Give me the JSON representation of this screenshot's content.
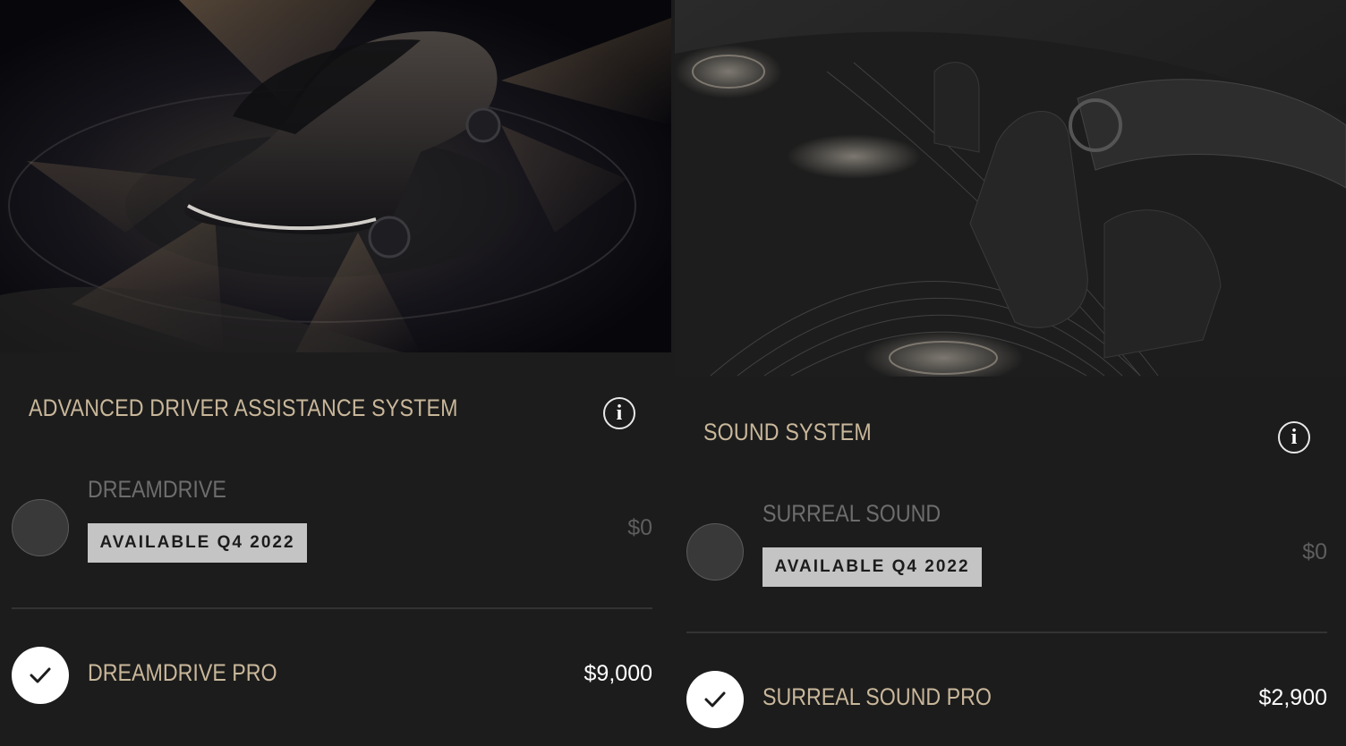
{
  "adas": {
    "title": "ADVANCED DRIVER ASSISTANCE SYSTEM",
    "info_glyph": "i",
    "options": [
      {
        "name": "DREAMDRIVE",
        "badge": "AVAILABLE Q4 2022",
        "price": "$0",
        "selected": false
      },
      {
        "name": "DREAMDRIVE PRO",
        "price": "$9,000",
        "selected": true
      }
    ]
  },
  "sound": {
    "title": "SOUND SYSTEM",
    "info_glyph": "i",
    "options": [
      {
        "name": "SURREAL SOUND",
        "badge": "AVAILABLE Q4 2022",
        "price": "$0",
        "selected": false
      },
      {
        "name": "SURREAL SOUND PRO",
        "price": "$2,900",
        "selected": true
      }
    ]
  },
  "icons": {
    "info": "info-icon",
    "check": "checkmark-icon"
  },
  "colors": {
    "background": "#1c1c1c",
    "accent_gold": "#c9b79a",
    "muted_text": "#6d6d6d",
    "badge_bg": "#c4c4c4",
    "divider": "#333333"
  }
}
